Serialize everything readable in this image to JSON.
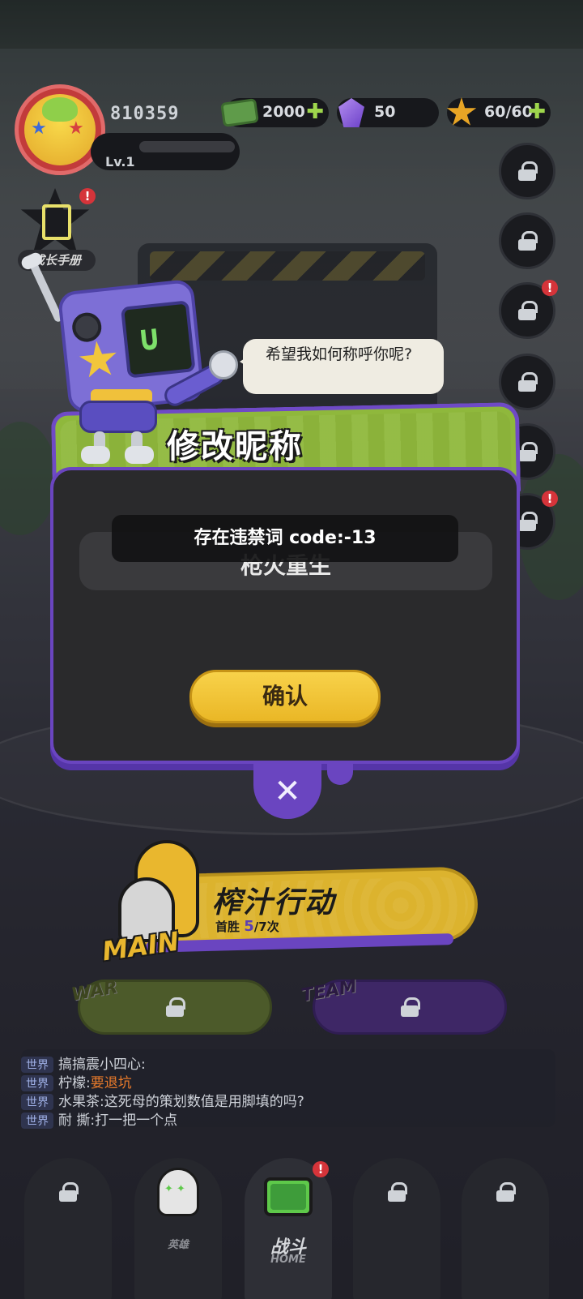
{
  "hud": {
    "player_id": "810359",
    "level": "Lv.1",
    "resources": [
      {
        "name": "cash",
        "value": "2000"
      },
      {
        "name": "gem",
        "value": "50"
      },
      {
        "name": "energy",
        "value": "60/60"
      }
    ]
  },
  "task_book": {
    "label": "成长手册",
    "alert": "!"
  },
  "side_menu": {
    "alert": "!"
  },
  "dialog": {
    "speech": "希望我如何称呼你呢?",
    "title": "修改昵称",
    "nickname_value": "枪火重生",
    "error_toast": "存在违禁词 code:-13",
    "confirm_label": "确认",
    "close_icon": "✕"
  },
  "main_mode": {
    "emblem": "MAIN",
    "title": "榨汁行动",
    "subtitle_prefix": "首胜",
    "progress_current": "5",
    "progress_suffix": "/7次"
  },
  "locked_modes": [
    {
      "tag": "WAR"
    },
    {
      "tag": "TEAM"
    }
  ],
  "chat": [
    {
      "channel": "世界",
      "text": "搞搞震小四心:"
    },
    {
      "channel": "世界",
      "speaker": "柠檬:",
      "text": "要退坑"
    },
    {
      "channel": "世界",
      "text": "水果茶:这死母的策划数值是用脚填的吗?"
    },
    {
      "channel": "世界",
      "text": "耐 撕:打一把一个点"
    }
  ],
  "bottom_nav": {
    "heroes_label": "英雄",
    "battle_label": "战斗",
    "battle_sub": "HOME",
    "alert": "!"
  },
  "colors": {
    "accent_purple": "#6a45c0",
    "confirm_yellow": "#f8d24a",
    "header_green": "#8fb83c",
    "alert_red": "#d5343a"
  }
}
